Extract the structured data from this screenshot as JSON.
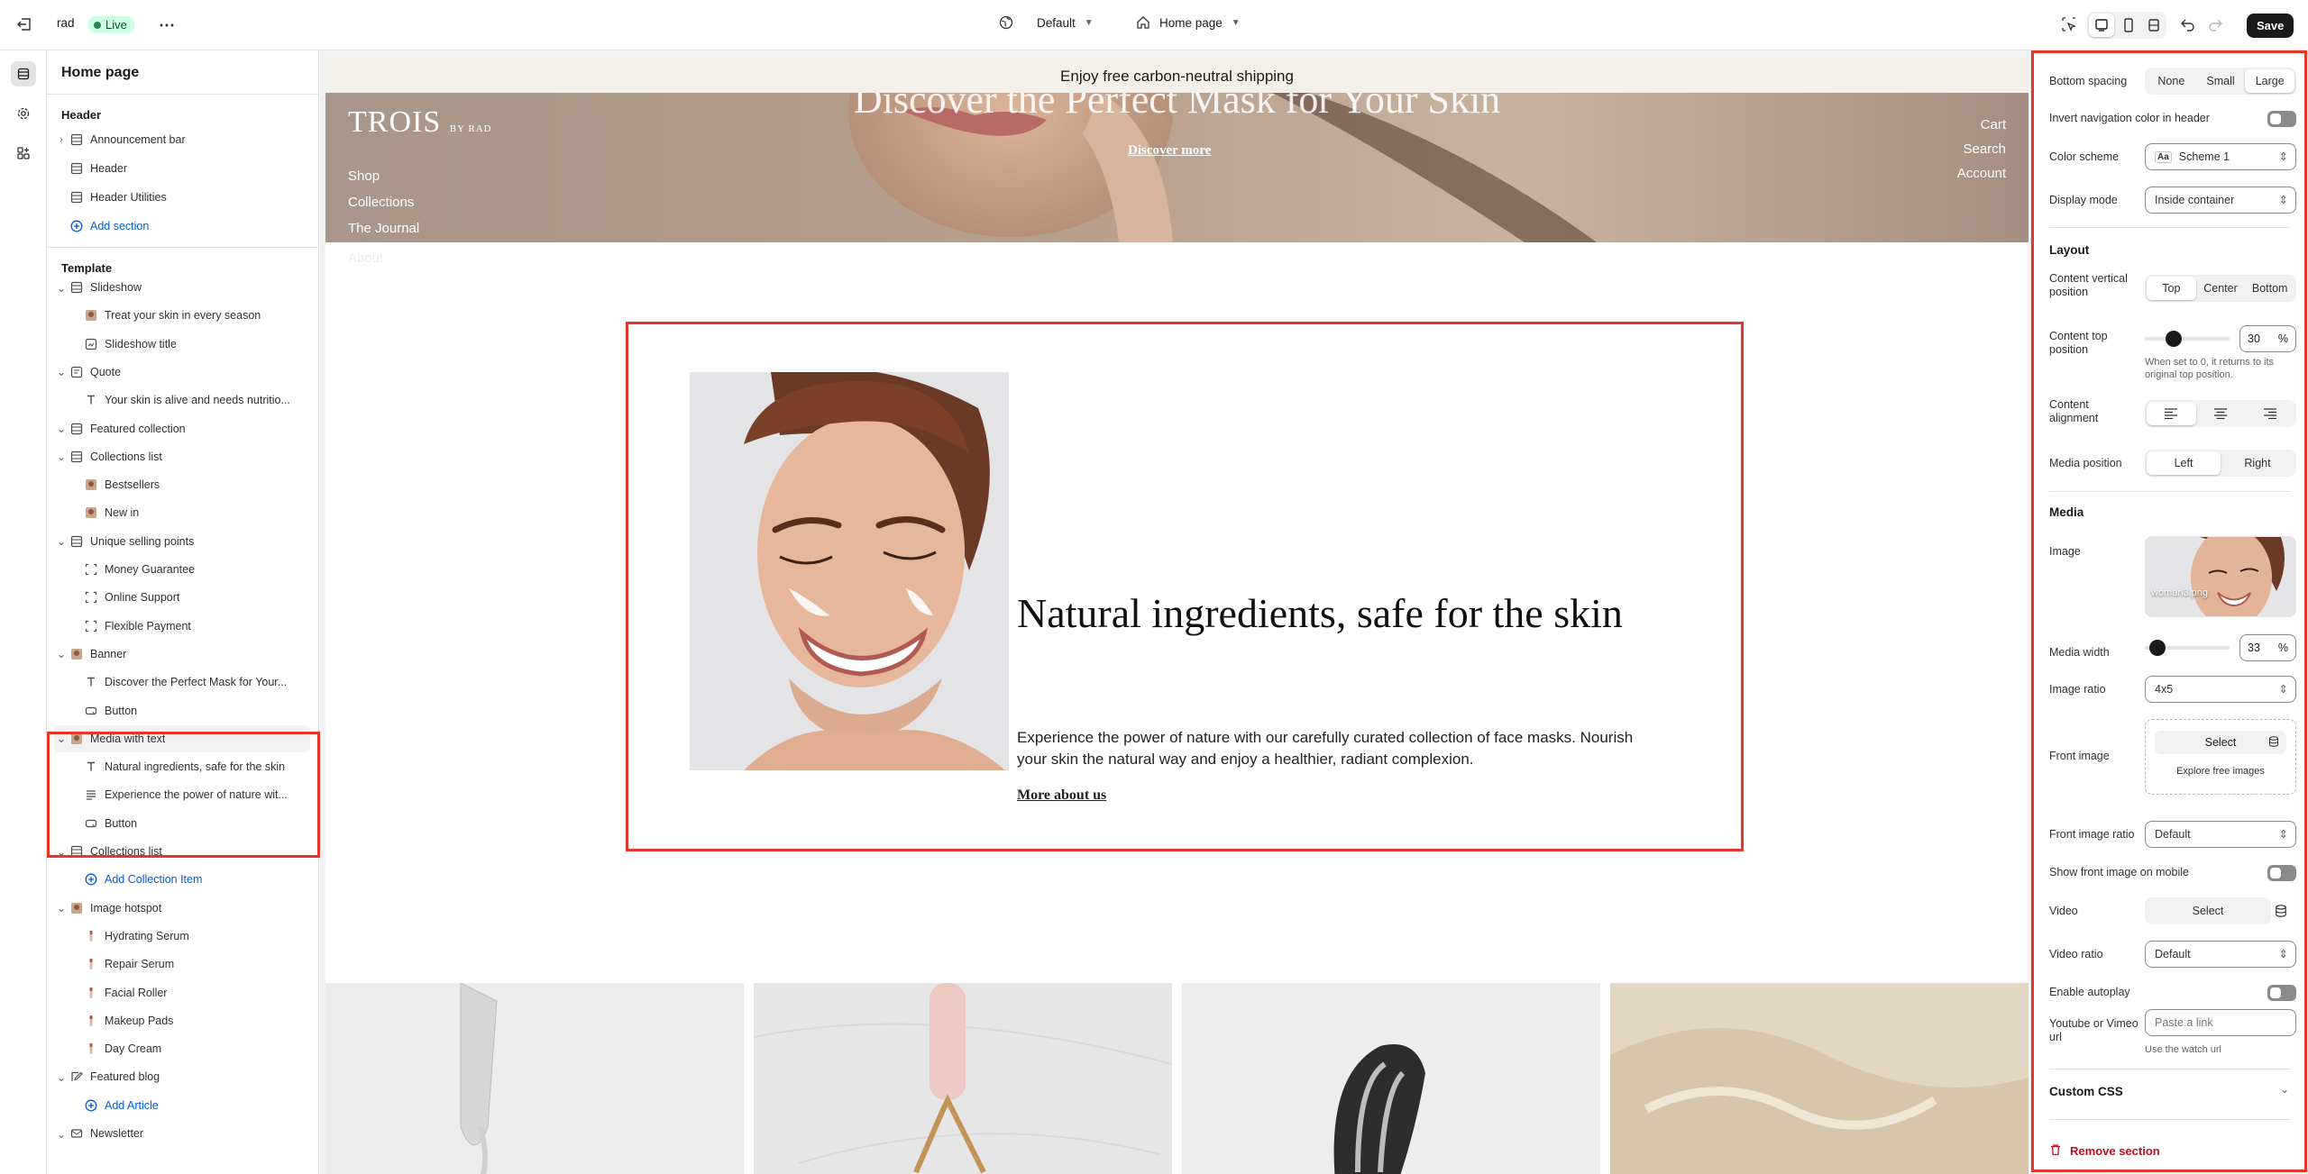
{
  "topbar": {
    "store_name": "rad",
    "live_label": "Live",
    "theme_select": "Default",
    "page_select": "Home page",
    "save_label": "Save"
  },
  "sidebar": {
    "title": "Home page",
    "header_group": "Header",
    "header_items": [
      "Announcement bar",
      "Header",
      "Header Utilities"
    ],
    "add_section": "Add section",
    "template_group": "Template",
    "items": [
      {
        "label": "Slideshow",
        "level": 0,
        "icon": "section-icon"
      },
      {
        "label": "Treat your skin in every season",
        "level": 1,
        "icon": "image-thumb-icon"
      },
      {
        "label": "Slideshow title",
        "level": 1,
        "icon": "slide-icon"
      },
      {
        "label": "Quote",
        "level": 0,
        "icon": "quote-icon"
      },
      {
        "label": "Your skin is alive and needs nutritio...",
        "level": 1,
        "icon": "text-icon"
      },
      {
        "label": "Featured collection",
        "level": 0,
        "icon": "section-icon"
      },
      {
        "label": "Collections list",
        "level": 0,
        "icon": "section-icon"
      },
      {
        "label": "Bestsellers",
        "level": 1,
        "icon": "image-thumb-icon"
      },
      {
        "label": "New in",
        "level": 1,
        "icon": "image-thumb-icon"
      },
      {
        "label": "Unique selling points",
        "level": 0,
        "icon": "section-icon"
      },
      {
        "label": "Money Guarantee",
        "level": 1,
        "icon": "block-icon"
      },
      {
        "label": "Online Support",
        "level": 1,
        "icon": "block-icon"
      },
      {
        "label": "Flexible Payment",
        "level": 1,
        "icon": "block-icon"
      },
      {
        "label": "Banner",
        "level": 0,
        "icon": "image-thumb-icon"
      },
      {
        "label": "Discover the Perfect Mask for Your...",
        "level": 1,
        "icon": "text-icon"
      },
      {
        "label": "Button",
        "level": 1,
        "icon": "button-icon"
      },
      {
        "label": "Media with text",
        "level": 0,
        "icon": "image-thumb-icon"
      },
      {
        "label": "Natural ingredients, safe for the skin",
        "level": 1,
        "icon": "text-icon"
      },
      {
        "label": "Experience the power of nature wit...",
        "level": 1,
        "icon": "paragraph-icon"
      },
      {
        "label": "Button",
        "level": 1,
        "icon": "button-icon"
      },
      {
        "label": "Collections list",
        "level": 0,
        "icon": "section-icon"
      },
      {
        "label": "Add Collection Item",
        "level": 1,
        "icon": "add-icon"
      },
      {
        "label": "Image hotspot",
        "level": 0,
        "icon": "image-thumb-icon"
      },
      {
        "label": "Hydrating Serum",
        "level": 1,
        "icon": "hotspot-icon"
      },
      {
        "label": "Repair Serum",
        "level": 1,
        "icon": "hotspot-icon"
      },
      {
        "label": "Facial Roller",
        "level": 1,
        "icon": "hotspot-icon"
      },
      {
        "label": "Makeup Pads",
        "level": 1,
        "icon": "hotspot-icon"
      },
      {
        "label": "Day Cream",
        "level": 1,
        "icon": "hotspot-icon"
      },
      {
        "label": "Featured blog",
        "level": 0,
        "icon": "blog-icon"
      },
      {
        "label": "Add Article",
        "level": 1,
        "icon": "add-icon"
      },
      {
        "label": "Newsletter",
        "level": 0,
        "icon": "mail-icon"
      }
    ]
  },
  "preview": {
    "announcement": "Enjoy free carbon-neutral shipping",
    "hero_heading": "Discover the Perfect Mask for Your Skin",
    "hero_button": "Discover more",
    "logo": "TROIS",
    "logo_sub": "BY RAD",
    "nav_left": [
      "Shop",
      "Collections",
      "The Journal",
      "About"
    ],
    "nav_right": [
      "Cart",
      "Search",
      "Account"
    ],
    "mwt_heading": "Natural ingredients, safe for the skin",
    "mwt_body": "Experience the power of nature with our carefully curated collection of face masks. Nourish your skin the natural way and enjoy a healthier, radiant complexion.",
    "mwt_link": "More about us"
  },
  "settings": {
    "bottom_spacing": {
      "label": "Bottom spacing",
      "options": [
        "None",
        "Small",
        "Large"
      ],
      "selected": "Large"
    },
    "invert_nav": "Invert navigation color in header",
    "color_scheme": {
      "label": "Color scheme",
      "value": "Scheme 1"
    },
    "display_mode": {
      "label": "Display mode",
      "value": "Inside container"
    },
    "layout_heading": "Layout",
    "content_vertical": {
      "label": "Content vertical position",
      "options": [
        "Top",
        "Center",
        "Bottom"
      ],
      "selected": "Top"
    },
    "content_top": {
      "label": "Content top position",
      "value": "30",
      "unit": "%",
      "fraction": 0.3,
      "hint": "When set to 0, it returns to its original top position."
    },
    "content_alignment": {
      "label": "Content alignment"
    },
    "media_position": {
      "label": "Media position",
      "options": [
        "Left",
        "Right"
      ],
      "selected": "Left"
    },
    "media_heading": "Media",
    "image": {
      "label": "Image",
      "filename": "woman3.png"
    },
    "media_width": {
      "label": "Media width",
      "value": "33",
      "unit": "%"
    },
    "image_ratio": {
      "label": "Image ratio",
      "value": "4x5"
    },
    "front_image": {
      "label": "Front image",
      "select": "Select",
      "explore": "Explore free images"
    },
    "front_image_ratio": {
      "label": "Front image ratio",
      "value": "Default"
    },
    "show_front_mobile": "Show front image on mobile",
    "video": {
      "label": "Video",
      "select": "Select"
    },
    "video_ratio": {
      "label": "Video ratio",
      "value": "Default"
    },
    "enable_autoplay": "Enable autoplay",
    "youtube": {
      "label": "Youtube or Vimeo url",
      "placeholder": "Paste a link",
      "hint": "Use the watch url"
    },
    "custom_css": "Custom CSS",
    "remove_section": "Remove section"
  },
  "colors": {
    "accent_red": "#e4372b",
    "live_bg": "#cdfee1",
    "link_blue": "#005bd3",
    "announcement_bg": "#f3efe9"
  }
}
